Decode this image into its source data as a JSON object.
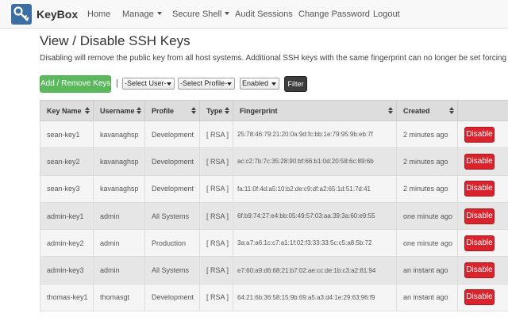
{
  "nav": {
    "brand": "KeyBox",
    "items": [
      {
        "label": "Home",
        "dropdown": false
      },
      {
        "label": "Manage",
        "dropdown": true
      },
      {
        "label": "Secure Shell",
        "dropdown": true
      },
      {
        "label": "Audit Sessions",
        "dropdown": false
      },
      {
        "label": "Change Password",
        "dropdown": false
      },
      {
        "label": "Logout",
        "dropdown": false
      }
    ]
  },
  "page": {
    "title": "View / Disable SSH Keys",
    "description": "Disabling will remove the public key from all host systems. Additional SSH keys with the same fingerprint can no longer be set forcing users t"
  },
  "toolbar": {
    "add_remove_label": "Add / Remove Keys",
    "separator": "|",
    "user_select": "-Select User-",
    "profile_select": "-Select Profile-",
    "status_select": "Enabled",
    "filter_label": "Filter"
  },
  "colors": {
    "green": "#5cb85c",
    "red": "#d9232d",
    "dark": "#3d3d3d",
    "logo_blue": "#3a6ea5"
  },
  "table": {
    "headers": [
      "Key Name",
      "Username",
      "Profile",
      "Type",
      "Fingerprint",
      "Created",
      ""
    ],
    "disable_label": "Disable",
    "rows": [
      {
        "key_name": "sean-key1",
        "username": "kavanaghsp",
        "profile": "Development",
        "type": "[ RSA ]",
        "fingerprint": "25:78:46:79:21:20:0a:9d:fc:bb:1e:79:95:9b:eb:7f",
        "created": "2 minutes ago"
      },
      {
        "key_name": "sean-key2",
        "username": "kavanaghsp",
        "profile": "Development",
        "type": "[ RSA ]",
        "fingerprint": "ac:c2:7b:7c:35:28:90:bf:66:b1:0d:20:58:6c:89:6b",
        "created": "2 minutes ago"
      },
      {
        "key_name": "sean-key3",
        "username": "kavanaghsp",
        "profile": "Development",
        "type": "[ RSA ]",
        "fingerprint": "fa:11:0f:4d:a5:10:b2:de:c9:df:a2:65:1d:51:7d:41",
        "created": "2 minutes ago"
      },
      {
        "key_name": "admin-key1",
        "username": "admin",
        "profile": "All Systems",
        "type": "[ RSA ]",
        "fingerprint": "6f:b9:74:27:e4:bb:05:49:57:03:aa:39:3a:60:e9:55",
        "created": "one minute ago"
      },
      {
        "key_name": "admin-key2",
        "username": "admin",
        "profile": "Production",
        "type": "[ RSA ]",
        "fingerprint": "3a:a7:a6:1c:c7:a1:1f:02:f3:33:33:5c:c5:a8:5b:72",
        "created": "one minute ago"
      },
      {
        "key_name": "admin-key3",
        "username": "admin",
        "profile": "All Systems",
        "type": "[ RSA ]",
        "fingerprint": "e7:60:a9:d6:68:21:b7:02:ae:cc:de:1b:c3:a2:81:94",
        "created": "an instant ago"
      },
      {
        "key_name": "thomas-key1",
        "username": "thomasgt",
        "profile": "Development",
        "type": "[ RSA ]",
        "fingerprint": "64:21:6b:36:58:15:9b:69:a5:a3:d4:1e:29:63:96:f9",
        "created": "an instant ago"
      }
    ]
  }
}
